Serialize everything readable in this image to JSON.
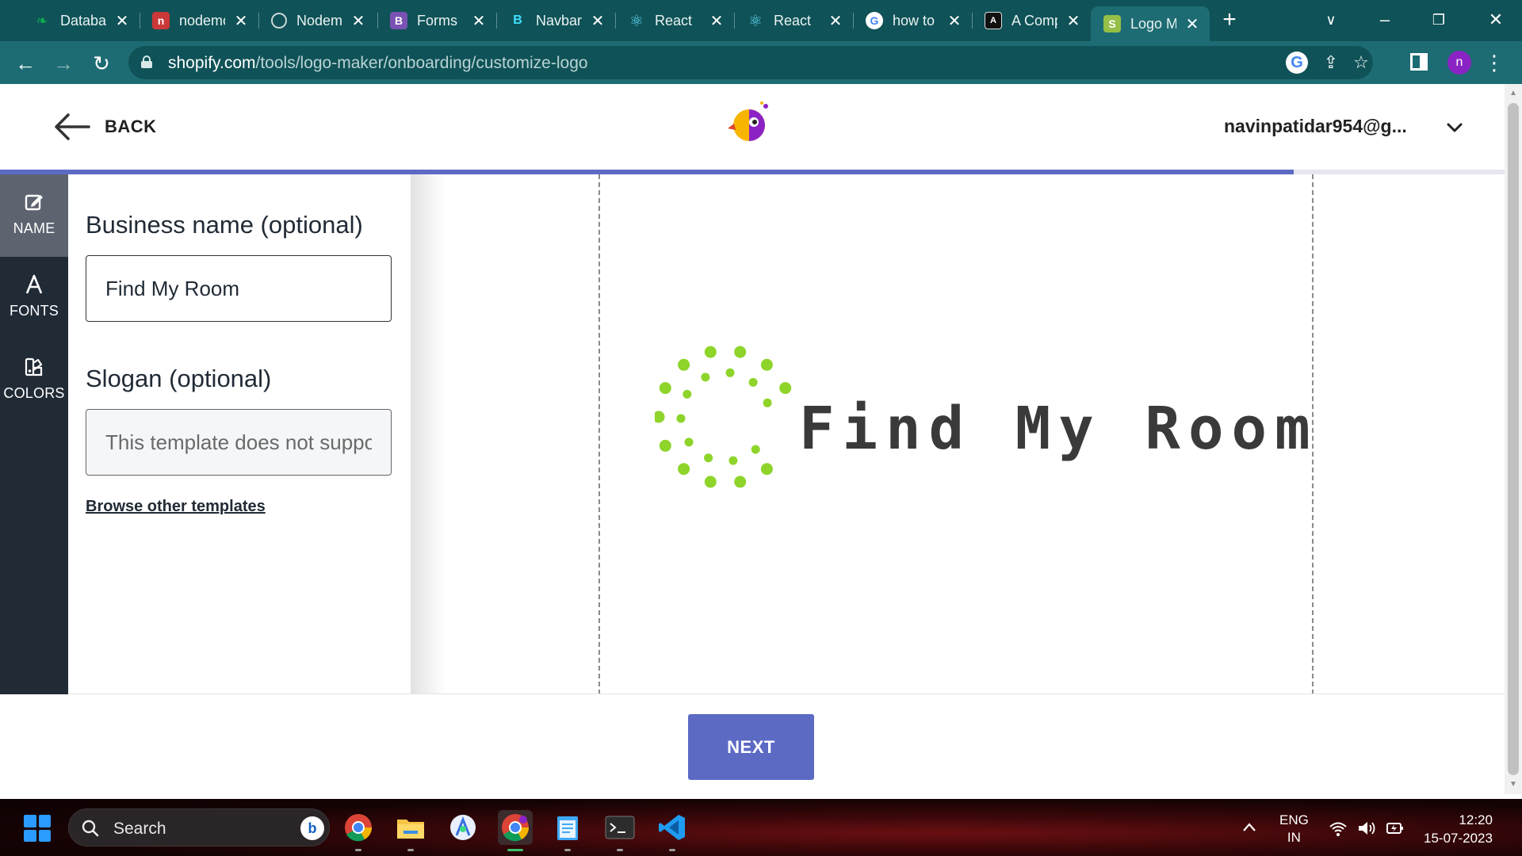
{
  "browser": {
    "tabs": [
      {
        "label": "Database",
        "icon": "mongodb-leaf-icon",
        "color": "#10aa50"
      },
      {
        "label": "nodemon",
        "icon": "npm-icon",
        "color": "#cb3837"
      },
      {
        "label": "Nodemailer",
        "icon": "chatgpt-icon",
        "color": "#74aa9c"
      },
      {
        "label": "Forms",
        "icon": "bootstrap-icon",
        "color": "#7952b3"
      },
      {
        "label": "Navbar",
        "icon": "react-bootstrap-icon",
        "color": "#41e0fd"
      },
      {
        "label": "React",
        "icon": "react-icon",
        "color": "#61dafb"
      },
      {
        "label": "React",
        "icon": "react-icon",
        "color": "#61dafb"
      },
      {
        "label": "how to",
        "icon": "google-icon",
        "color": "#4285f4"
      },
      {
        "label": "A Comp",
        "icon": "angular-devkit-icon",
        "color": "#ffffff"
      },
      {
        "label": "Logo M",
        "icon": "shopify-icon",
        "color": "#95bf47"
      }
    ],
    "active_tab_index": 9,
    "url_host": "shopify.com",
    "url_path": "/tools/logo-maker/onboarding/customize-logo",
    "profile_initial": "n",
    "profile_color": "#8b23c4"
  },
  "header": {
    "back_label": "BACK",
    "account_email": "navinpatidar954@g..."
  },
  "progress": {
    "fraction": 0.86,
    "color": "#5c6ac4"
  },
  "rail": {
    "items": [
      {
        "label": "NAME",
        "icon": "edit-icon",
        "active": true
      },
      {
        "label": "FONTS",
        "icon": "font-icon",
        "active": false
      },
      {
        "label": "COLORS",
        "icon": "palette-icon",
        "active": false
      }
    ]
  },
  "form": {
    "business_label": "Business name (optional)",
    "business_value": "Find My Room",
    "slogan_label": "Slogan (optional)",
    "slogan_placeholder": "This template does not support slogans",
    "browse_link": "Browse other templates"
  },
  "canvas": {
    "logo_text": "Find My Room",
    "logo_text_color": "#3a3a3a",
    "logo_mark_color": "#8ed42a"
  },
  "footer": {
    "next_label": "NEXT",
    "accent": "#5c6ac4"
  },
  "taskbar": {
    "search_placeholder": "Search",
    "lang_line1": "ENG",
    "lang_line2": "IN",
    "time": "12:20",
    "date": "15-07-2023"
  }
}
